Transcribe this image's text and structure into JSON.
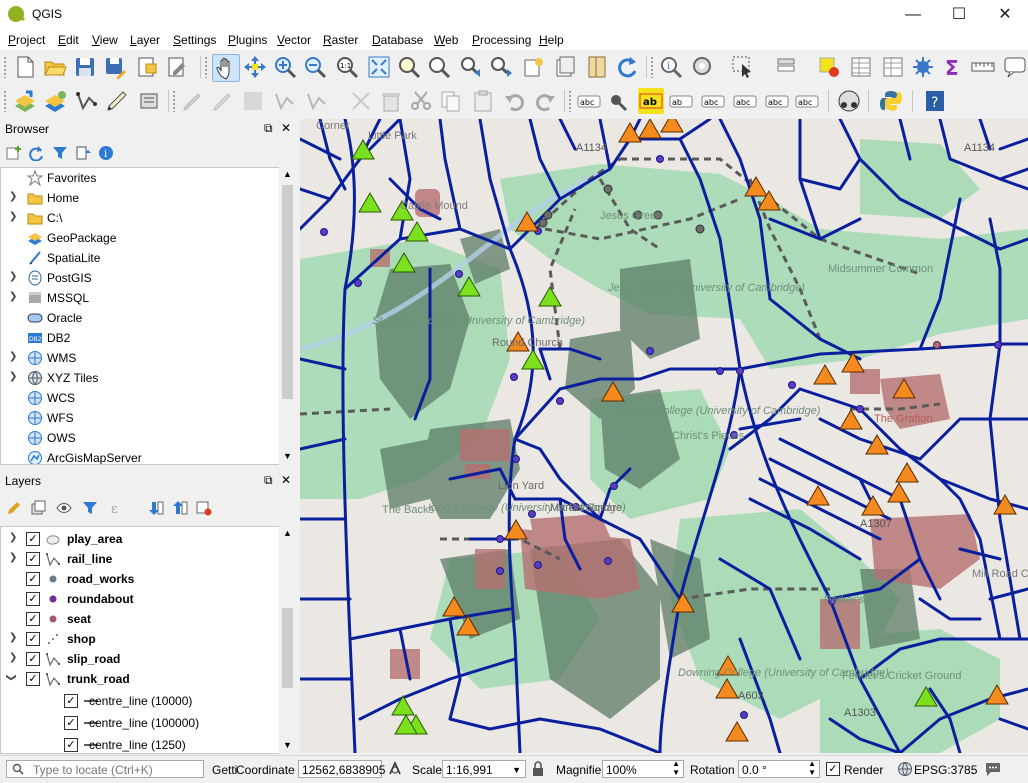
{
  "window": {
    "title": "QGIS",
    "minimize": "—",
    "maximize": "☐",
    "close": "✕"
  },
  "menu": [
    "Project",
    "Edit",
    "View",
    "Layer",
    "Settings",
    "Plugins",
    "Vector",
    "Raster",
    "Database",
    "Web",
    "Processing",
    "Help"
  ],
  "toolbar1": [
    "new-project-icon",
    "open-project-icon",
    "save-project-icon",
    "save-as-icon",
    "new-print-layout-icon",
    "layout-manager-icon",
    "pan-icon",
    "pan-to-selection-icon",
    "zoom-in-icon",
    "zoom-out-icon",
    "zoom-native-icon",
    "zoom-full-icon",
    "zoom-to-selection-icon",
    "zoom-to-layer-icon",
    "zoom-last-icon",
    "zoom-next-icon",
    "new-bookmark-icon",
    "show-bookmarks-icon",
    "map-tips-icon",
    "refresh-icon",
    "identify-icon",
    "action-icon",
    "select-icon",
    "attribute-select-icon",
    "deselect-icon",
    "attribute-table-icon",
    "field-calculator-icon",
    "statistics-icon",
    "sum-icon",
    "measure-icon",
    "annotation-icon"
  ],
  "toolbar2": [
    "data-source-manager-icon",
    "new-geopackage-icon",
    "new-shapefile-icon",
    "digitize-icon",
    "gps-icon",
    "current-edits-icon",
    "toggle-editing-icon",
    "save-edits-icon",
    "add-feature-icon",
    "vertex-tool-icon",
    "delete-icon",
    "cut-icon",
    "copy-icon",
    "paste-icon",
    "undo-icon",
    "redo-icon",
    "label-icon",
    "label-pin-icon",
    "label-highlight-icon",
    "label-move-icon",
    "label-show-icon",
    "label-rotate-icon",
    "label-change-icon",
    "label-props-icon",
    "python-console-icon",
    "help-icon"
  ],
  "browser": {
    "title": "Browser",
    "items": [
      {
        "label": "Favorites",
        "icon": "star-icon",
        "expand": false
      },
      {
        "label": "Home",
        "icon": "folder-icon",
        "expand": true
      },
      {
        "label": "C:\\",
        "icon": "folder-icon",
        "expand": true
      },
      {
        "label": "GeoPackage",
        "icon": "geopackage-icon",
        "expand": false
      },
      {
        "label": "SpatiaLite",
        "icon": "spatialite-icon",
        "expand": false
      },
      {
        "label": "PostGIS",
        "icon": "postgis-icon",
        "expand": true
      },
      {
        "label": "MSSQL",
        "icon": "mssql-icon",
        "expand": true
      },
      {
        "label": "Oracle",
        "icon": "oracle-icon",
        "expand": false
      },
      {
        "label": "DB2",
        "icon": "db2-icon",
        "expand": false
      },
      {
        "label": "WMS",
        "icon": "wms-icon",
        "expand": true
      },
      {
        "label": "XYZ Tiles",
        "icon": "xyz-icon",
        "expand": true
      },
      {
        "label": "WCS",
        "icon": "wcs-icon",
        "expand": false
      },
      {
        "label": "WFS",
        "icon": "wfs-icon",
        "expand": false
      },
      {
        "label": "OWS",
        "icon": "ows-icon",
        "expand": false
      },
      {
        "label": "ArcGisMapServer",
        "icon": "arcgis-icon",
        "expand": false
      }
    ]
  },
  "layers": {
    "title": "Layers",
    "items": [
      {
        "label": "play_area",
        "icon": "polygon-icon",
        "checked": true,
        "bold": true,
        "expand": "collapsed",
        "indent": 0
      },
      {
        "label": "rail_line",
        "icon": "line-icon",
        "checked": true,
        "bold": true,
        "expand": "collapsed",
        "indent": 0
      },
      {
        "label": "road_works",
        "icon": "point-gray-icon",
        "checked": true,
        "bold": true,
        "expand": "none",
        "indent": 0
      },
      {
        "label": "roundabout",
        "icon": "point-purple-icon",
        "checked": true,
        "bold": true,
        "expand": "none",
        "indent": 0
      },
      {
        "label": "seat",
        "icon": "point-pink-icon",
        "checked": true,
        "bold": true,
        "expand": "none",
        "indent": 0
      },
      {
        "label": "shop",
        "icon": "point-cluster-icon",
        "checked": true,
        "bold": true,
        "expand": "collapsed",
        "indent": 0
      },
      {
        "label": "slip_road",
        "icon": "line-icon",
        "checked": true,
        "bold": true,
        "expand": "collapsed",
        "indent": 0
      },
      {
        "label": "trunk_road",
        "icon": "line-icon",
        "checked": true,
        "bold": true,
        "expand": "expanded",
        "indent": 0
      },
      {
        "label": "centre_line (10000)",
        "icon": "legend-line-icon",
        "checked": true,
        "bold": false,
        "expand": "none",
        "indent": 1
      },
      {
        "label": "centre_line (100000)",
        "icon": "legend-line-icon",
        "checked": true,
        "bold": false,
        "expand": "none",
        "indent": 1
      },
      {
        "label": "centre_line (1250)",
        "icon": "legend-line-icon",
        "checked": true,
        "bold": false,
        "expand": "none",
        "indent": 1
      }
    ]
  },
  "map": {
    "labels": [
      "Castle Mound",
      "Jesus Green",
      "Jesus Green",
      "St John's College (University of Cambridge)",
      "Round Church",
      "Jesus College (University of Cambridge)",
      "Midsummer Common",
      "King's College (University of Cambridge)",
      "Christ's College (University of Cambridge)",
      "Christ's Pieces",
      "Lion Yard",
      "Market Square",
      "The Backs",
      "The Grafton",
      "Parker's Piece",
      "Mill Road Cemetery",
      "Downing College (University of Cambridge)",
      "Fenner's Cricket Ground",
      "A1134",
      "A1303",
      "A603",
      "A1307",
      "A1134",
      "Corner",
      "Little Park"
    ]
  },
  "status": {
    "locate_placeholder": "Type to locate (Ctrl+K)",
    "getting": "Getti",
    "coordinate_label": "Coordinate",
    "coordinate": "12562,6838905",
    "scale_label": "Scale",
    "scale": "1:16,991",
    "magnifier_label": "Magnifier",
    "magnifier": "100%",
    "rotation_label": "Rotation",
    "rotation": "0.0 °",
    "render_label": "Render",
    "render_checked": true,
    "crs": "EPSG:3785"
  },
  "colors": {
    "road": "#0a1f9e",
    "rail": "#5a5a5a",
    "park": "#a7d9b4",
    "building": "#a96c6c",
    "orange_marker": "#f58a1f",
    "green_marker": "#7be01e"
  }
}
